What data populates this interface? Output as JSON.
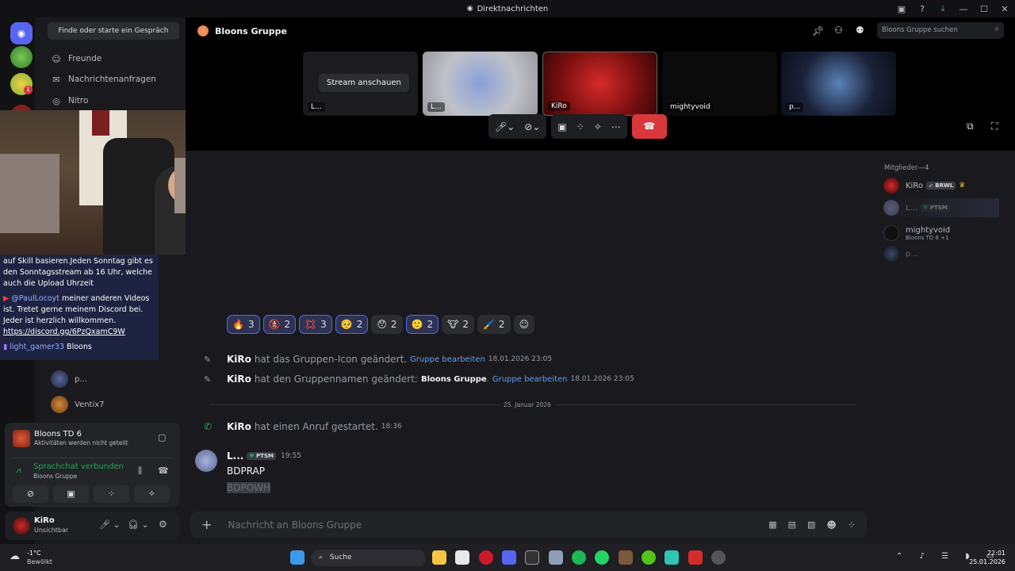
{
  "window": {
    "title": "Direktnachrichten"
  },
  "dm_sidebar": {
    "search_label": "Finde oder starte ein Gespräch",
    "nav": [
      {
        "label": "Freunde",
        "icon": "friends-icon"
      },
      {
        "label": "Nachrichtenanfragen",
        "icon": "mail-icon"
      },
      {
        "label": "Nitro",
        "icon": "nitro-icon"
      }
    ],
    "dms": [
      {
        "name": "p..."
      },
      {
        "name": "Ventix7"
      }
    ],
    "guild_badge": "1"
  },
  "overlay": {
    "yt_lines": [
      "auf Skill basieren.Jeden Sonntag gibt es",
      "den Sonntagsstream ab 16 Uhr, welche",
      "auch die Upload Uhrzeit"
    ],
    "yt_user": "@PaulLocoyt",
    "yt_text": "meiner anderen Videos ist. Tretet gerne meinem Discord bei. Jeder ist herzlich willkommen.",
    "yt_link": "https://discord.gg/6PzQxamC9W",
    "twitch_user": "light_gamer33",
    "twitch_text": "Bloons"
  },
  "activity": {
    "game": "Bloons TD 6",
    "sub": "Aktivitäten werden nicht geteilt"
  },
  "voice": {
    "status": "Sprachchat verbunden",
    "channel": "Bloons Gruppe"
  },
  "user": {
    "name": "KiRo",
    "status": "Unsichtbar"
  },
  "header": {
    "title": "Bloons Gruppe",
    "search_placeholder": "Bloons Gruppe suchen"
  },
  "call": {
    "stream_button": "Stream anschauen",
    "tiles": [
      "L...",
      "L...",
      "KiRo",
      "mightyvoid",
      "p..."
    ]
  },
  "messages": {
    "reactions": [
      {
        "emoji": "🔥",
        "count": "3",
        "me": true
      },
      {
        "emoji": "🚷",
        "count": "2",
        "me": true
      },
      {
        "emoji": "💢",
        "count": "3",
        "me": true
      },
      {
        "emoji": "🥺",
        "count": "2",
        "me": true
      },
      {
        "emoji": "😯",
        "count": "2",
        "me": false
      },
      {
        "emoji": "🙂",
        "count": "2",
        "me": true
      },
      {
        "emoji": "🐮",
        "count": "2",
        "me": false
      },
      {
        "emoji": "🖌️",
        "count": "2",
        "me": false
      }
    ],
    "sys1": {
      "user": "KiRo",
      "text": "hat das Gruppen-Icon geändert.",
      "link": "Gruppe bearbeiten",
      "time": "18.01.2026 23:05"
    },
    "sys2": {
      "user": "KiRo",
      "text": "hat den Gruppennamen geändert:",
      "name": "Bloons Gruppe",
      "link": "Gruppe bearbeiten",
      "time": "18.01.2026 23:05"
    },
    "divider": "25. Januar 2026",
    "call": {
      "user": "KiRo",
      "text": "hat einen Anruf gestartet.",
      "time": "18:36"
    },
    "post": {
      "user": "L...",
      "badge": "PTSM",
      "time": "19:55",
      "line1": "BDPRAP",
      "line2": "BDPOWH"
    }
  },
  "composer": {
    "placeholder": "Nachricht an Bloons Gruppe"
  },
  "members": {
    "header": "Mitglieder—4",
    "list": [
      {
        "name": "KiRo",
        "badge": "BRWL",
        "sub": ""
      },
      {
        "name": "L...",
        "badge": "PTSM",
        "sub": ""
      },
      {
        "name": "mightyvoid",
        "badge": "",
        "sub": "Bloons TD 6 +1"
      },
      {
        "name": "p...",
        "badge": "",
        "sub": ""
      }
    ]
  },
  "taskbar": {
    "weather_temp": "-1°C",
    "weather_desc": "Bewölkt",
    "search": "Suche",
    "time": "22:01",
    "date": "25.01.2026"
  }
}
